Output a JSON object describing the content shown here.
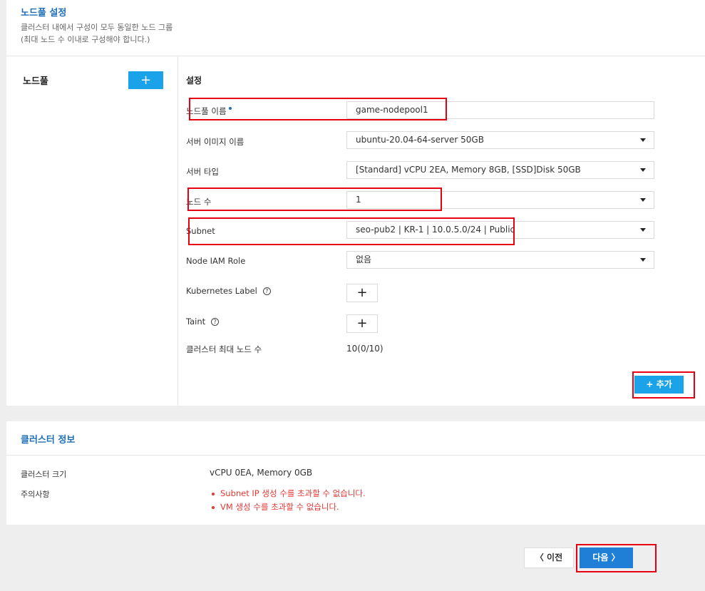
{
  "nodepool_section": {
    "title": "노드풀 설정",
    "desc_line1": "클러스터 내에서 구성이 모두 동일한 노드 그룹",
    "desc_line2": "(최대 노드 수 이내로 구성해야 합니다.)"
  },
  "nodepool_list": {
    "label": "노드풀",
    "add_icon": "plus-icon"
  },
  "settings": {
    "title": "설정",
    "nodepool_name": {
      "label": "노드풀 이름",
      "value": "game-nodepool1"
    },
    "server_image": {
      "label": "서버 이미지 이름",
      "value": "ubuntu-20.04-64-server 50GB"
    },
    "server_type": {
      "label": "서버 타입",
      "value": "[Standard] vCPU 2EA, Memory 8GB, [SSD]Disk 50GB"
    },
    "node_count": {
      "label": "노드 수",
      "value": "1"
    },
    "subnet": {
      "label": "Subnet",
      "value": "seo-pub2 | KR-1 | 10.0.5.0/24 | Public"
    },
    "iam_role": {
      "label": "Node IAM Role",
      "value": "없음"
    },
    "k8s_label": {
      "label": "Kubernetes Label",
      "help": "?"
    },
    "taint": {
      "label": "Taint",
      "help": "?"
    },
    "max_nodes": {
      "label": "클러스터 최대 노드 수",
      "value": "10(0/10)"
    },
    "add_button": "추가"
  },
  "cluster_info": {
    "title": "클러스터 정보",
    "size_label": "클러스터 크기",
    "size_value": "vCPU 0EA, Memory 0GB",
    "notice_label": "주의사항",
    "warnings": [
      "Subnet IP 생성 수를 초과할 수 없습니다.",
      "VM 생성 수를 초과할 수 없습니다."
    ]
  },
  "footer": {
    "prev_label": "이전",
    "next_label": "다음"
  },
  "colors": {
    "accent": "#1aa3e8",
    "primary": "#1f7fd6",
    "title_blue": "#1f6fb7",
    "warning": "#e53935",
    "highlight": "#e60012"
  }
}
